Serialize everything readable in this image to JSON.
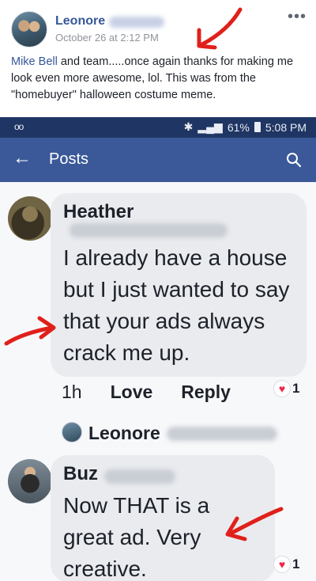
{
  "post": {
    "author": "Leonore",
    "timestamp": "October 26 at 2:12 PM",
    "more_label": "•••",
    "mention": "Mike Bell",
    "text": " and team.....once again thanks for making me look even more awesome, lol. This was from the \"homebuyer\" halloween costume meme."
  },
  "status_bar": {
    "left_icon": "voicemail-icon",
    "battery": "61%",
    "time": "5:08 PM"
  },
  "app_bar": {
    "back_icon": "back-arrow-icon",
    "title": "Posts",
    "search_icon": "search-icon",
    "color": "#3b5998"
  },
  "comments": [
    {
      "author": "Heather",
      "text": "I already have a house but I just wanted to say that your ads always crack me up.",
      "time": "1h",
      "like_label": "Love",
      "reply_label": "Reply",
      "reaction_count": "1"
    },
    {
      "author": "Buz",
      "text": "Now THAT is a great ad. Very creative.",
      "reaction_count": "1"
    }
  ],
  "reply_preview": {
    "author": "Leonore"
  },
  "colors": {
    "link": "#365899",
    "annotation": "#e0201b",
    "heart": "#f02849"
  }
}
